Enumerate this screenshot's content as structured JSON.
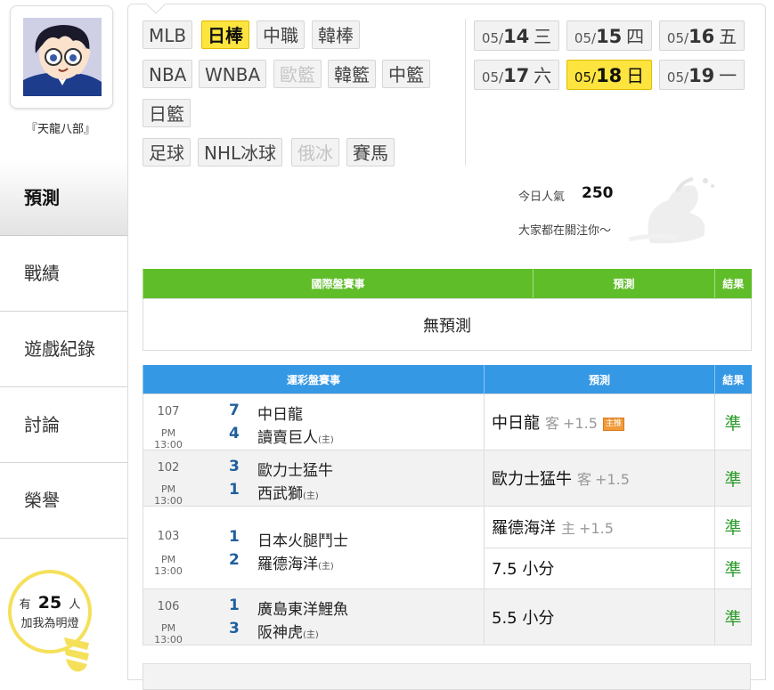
{
  "user": {
    "name": "『天龍八部』"
  },
  "sidebar": {
    "items": [
      {
        "label": "預測",
        "active": true
      },
      {
        "label": "戰績",
        "active": false
      },
      {
        "label": "遊戲紀錄",
        "active": false
      },
      {
        "label": "討論",
        "active": false
      },
      {
        "label": "榮譽",
        "active": false
      }
    ],
    "fans": {
      "prefix": "有",
      "count": "25",
      "suffix": "人",
      "line2": "加我為明燈"
    }
  },
  "sports": [
    {
      "label": "MLB",
      "state": "normal"
    },
    {
      "label": "日棒",
      "state": "active"
    },
    {
      "label": "中職",
      "state": "normal"
    },
    {
      "label": "韓棒",
      "state": "normal"
    },
    {
      "label": "NBA",
      "state": "normal"
    },
    {
      "label": "WNBA",
      "state": "normal"
    },
    {
      "label": "歐籃",
      "state": "disabled"
    },
    {
      "label": "韓籃",
      "state": "normal"
    },
    {
      "label": "中籃",
      "state": "normal"
    },
    {
      "label": "日籃",
      "state": "normal"
    },
    {
      "label": "足球",
      "state": "normal"
    },
    {
      "label": "NHL冰球",
      "state": "normal"
    },
    {
      "label": "俄冰",
      "state": "disabled"
    },
    {
      "label": "賽馬",
      "state": "normal"
    }
  ],
  "dates": [
    {
      "mm": "05/",
      "dd": "14",
      "wd": "三",
      "active": false
    },
    {
      "mm": "05/",
      "dd": "15",
      "wd": "四",
      "active": false
    },
    {
      "mm": "05/",
      "dd": "16",
      "wd": "五",
      "active": false
    },
    {
      "mm": "05/",
      "dd": "17",
      "wd": "六",
      "active": false
    },
    {
      "mm": "05/",
      "dd": "18",
      "wd": "日",
      "active": true
    },
    {
      "mm": "05/",
      "dd": "19",
      "wd": "一",
      "active": false
    }
  ],
  "popularity": {
    "label": "今日人氣",
    "count": "250",
    "sub": "大家都在關注你～"
  },
  "intl_table": {
    "headers": [
      "國際盤賽事",
      "預測",
      "結果"
    ],
    "empty_text": "無預測",
    "color": "#60bd2a"
  },
  "lottery_table": {
    "headers": [
      "運彩盤賽事",
      "預測",
      "結果"
    ],
    "color": "#3598e4",
    "home_mark": "(主)",
    "games": [
      {
        "no": "107",
        "time": "PM 13:00",
        "away": {
          "score": "7",
          "team": "中日龍"
        },
        "home": {
          "score": "4",
          "team": "讀賣巨人"
        },
        "predictions": [
          {
            "pick": "中日龍",
            "side": "客",
            "line": "+1.5",
            "badge": "主推",
            "result": "準"
          }
        ]
      },
      {
        "no": "102",
        "time": "PM 13:00",
        "away": {
          "score": "3",
          "team": "歐力士猛牛"
        },
        "home": {
          "score": "1",
          "team": "西武獅"
        },
        "predictions": [
          {
            "pick": "歐力士猛牛",
            "side": "客",
            "line": "+1.5",
            "badge": "",
            "result": "準"
          }
        ]
      },
      {
        "no": "103",
        "time": "PM 13:00",
        "away": {
          "score": "1",
          "team": "日本火腿鬥士"
        },
        "home": {
          "score": "2",
          "team": "羅德海洋"
        },
        "predictions": [
          {
            "pick": "羅德海洋",
            "side": "主",
            "line": "+1.5",
            "badge": "",
            "result": "準"
          },
          {
            "pick": "7.5 小分",
            "side": "",
            "line": "",
            "badge": "",
            "result": "準"
          }
        ]
      },
      {
        "no": "106",
        "time": "PM 13:00",
        "away": {
          "score": "1",
          "team": "廣島東洋鯉魚"
        },
        "home": {
          "score": "3",
          "team": "阪神虎"
        },
        "predictions": [
          {
            "pick": "5.5 小分",
            "side": "",
            "line": "",
            "badge": "",
            "result": "準"
          }
        ]
      }
    ]
  }
}
